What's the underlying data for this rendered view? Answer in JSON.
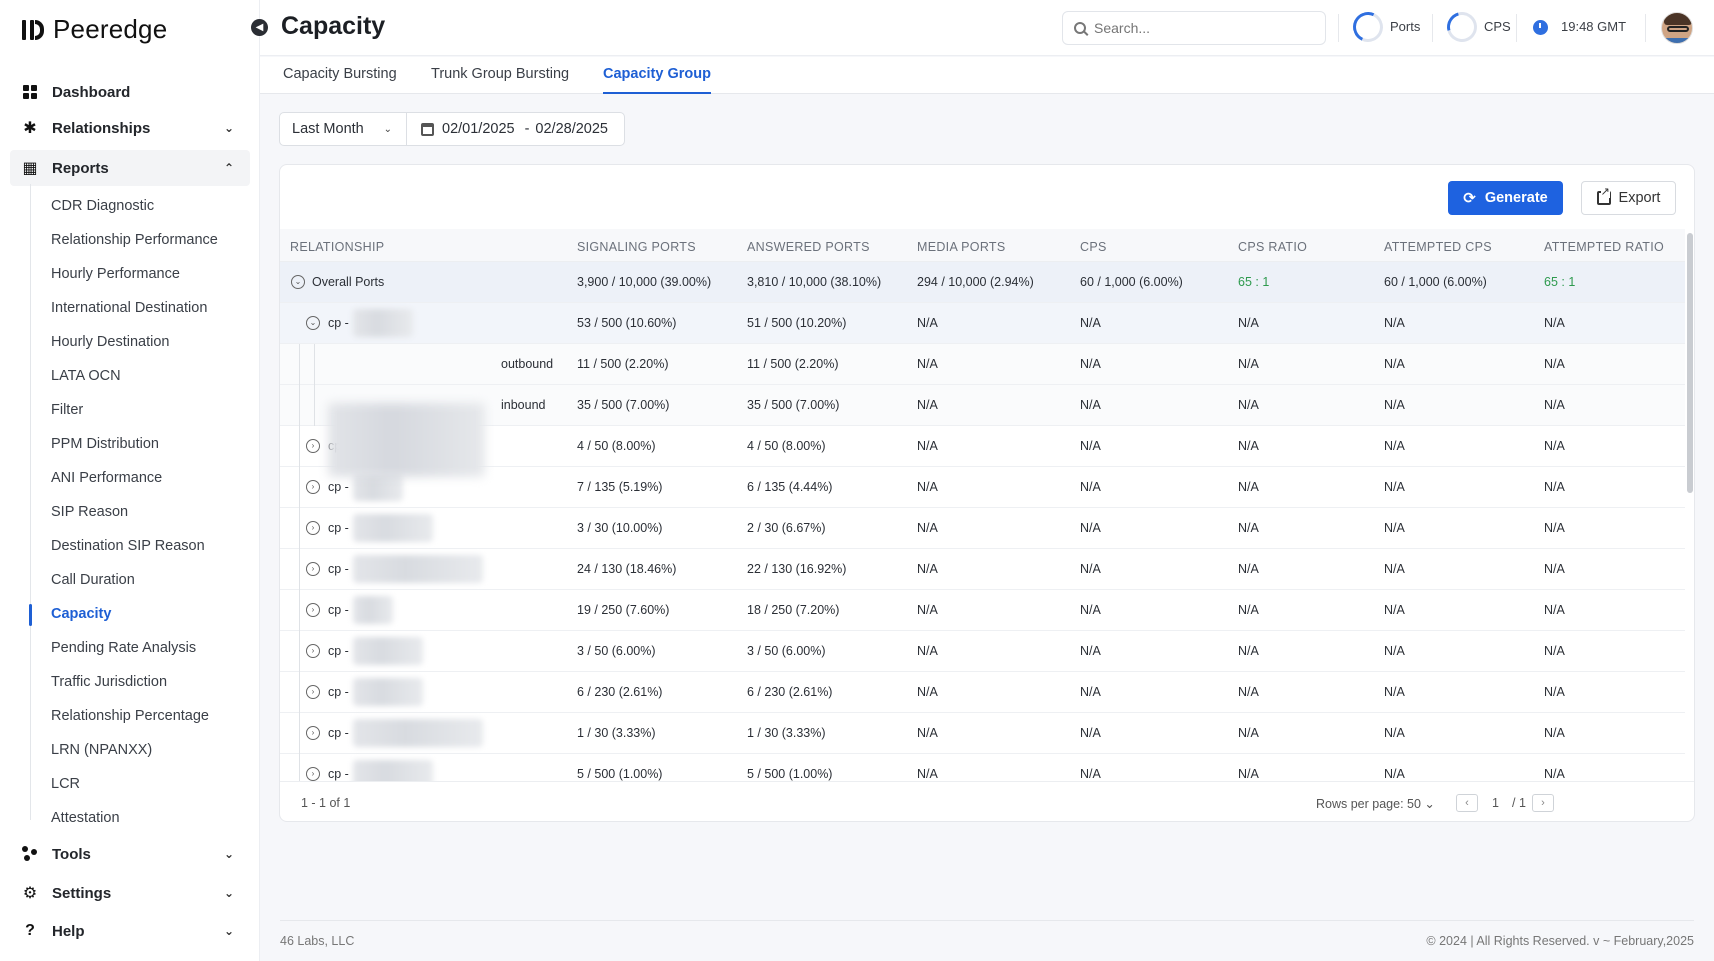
{
  "brand": {
    "name": "Peeredge"
  },
  "header": {
    "title": "Capacity",
    "search_placeholder": "Search...",
    "ports_label": "Ports",
    "cps_label": "CPS",
    "time": "19:48 GMT"
  },
  "nav": {
    "dashboard": "Dashboard",
    "relationships": "Relationships",
    "reports": "Reports",
    "tools": "Tools",
    "settings": "Settings",
    "help": "Help",
    "report_items": [
      "CDR Diagnostic",
      "Relationship Performance",
      "Hourly Performance",
      "International Destination",
      "Hourly Destination",
      "LATA OCN",
      "Filter",
      "PPM Distribution",
      "ANI Performance",
      "SIP Reason",
      "Destination SIP Reason",
      "Call Duration",
      "Capacity",
      "Pending Rate Analysis",
      "Traffic Jurisdiction",
      "Relationship Percentage",
      "LRN (NPANXX)",
      "LCR",
      "Attestation"
    ],
    "active_report": "Capacity"
  },
  "tabs": [
    "Capacity Bursting",
    "Trunk Group Bursting",
    "Capacity Group"
  ],
  "active_tab": "Capacity Group",
  "filter": {
    "period": "Last Month",
    "date_from": "02/01/2025",
    "date_sep": "-",
    "date_to": "02/28/2025"
  },
  "actions": {
    "generate": "Generate",
    "export": "Export"
  },
  "table": {
    "columns": [
      "RELATIONSHIP",
      "SIGNALING PORTS",
      "ANSWERED PORTS",
      "MEDIA PORTS",
      "CPS",
      "CPS RATIO",
      "ATTEMPTED CPS",
      "ATTEMPTED RATIO"
    ],
    "overall": {
      "relationship": "Overall Ports",
      "signaling": "3,900 / 10,000 (39.00%)",
      "answered": "3,810 / 10,000 (38.10%)",
      "media": "294 / 10,000 (2.94%)",
      "cps": "60 / 1,000 (6.00%)",
      "cps_ratio": "65 : 1",
      "attempted_cps": "60 / 1,000 (6.00%)",
      "attempted_ratio": "65 : 1"
    },
    "rows": [
      {
        "kind": "cp-open",
        "relationship": "cp -",
        "signaling": "53 / 500 (10.60%)",
        "answered": "51 / 500 (10.20%)",
        "media": "N/A",
        "cps": "N/A",
        "cps_ratio": "N/A",
        "attempted_cps": "N/A",
        "attempted_ratio": "N/A"
      },
      {
        "kind": "child",
        "relationship": "outbound",
        "signaling": "11 / 500 (2.20%)",
        "answered": "11 / 500 (2.20%)",
        "media": "N/A",
        "cps": "N/A",
        "cps_ratio": "N/A",
        "attempted_cps": "N/A",
        "attempted_ratio": "N/A"
      },
      {
        "kind": "child",
        "relationship": "inbound",
        "signaling": "35 / 500 (7.00%)",
        "answered": "35 / 500 (7.00%)",
        "media": "N/A",
        "cps": "N/A",
        "cps_ratio": "N/A",
        "attempted_cps": "N/A",
        "attempted_ratio": "N/A"
      },
      {
        "kind": "cp",
        "relationship": "cp -",
        "signaling": "4 / 50 (8.00%)",
        "answered": "4 / 50 (8.00%)",
        "media": "N/A",
        "cps": "N/A",
        "cps_ratio": "N/A",
        "attempted_cps": "N/A",
        "attempted_ratio": "N/A"
      },
      {
        "kind": "cp",
        "relationship": "cp -",
        "signaling": "7 / 135 (5.19%)",
        "answered": "6 / 135 (4.44%)",
        "media": "N/A",
        "cps": "N/A",
        "cps_ratio": "N/A",
        "attempted_cps": "N/A",
        "attempted_ratio": "N/A"
      },
      {
        "kind": "cp",
        "relationship": "cp -",
        "signaling": "3 / 30 (10.00%)",
        "answered": "2 / 30 (6.67%)",
        "media": "N/A",
        "cps": "N/A",
        "cps_ratio": "N/A",
        "attempted_cps": "N/A",
        "attempted_ratio": "N/A"
      },
      {
        "kind": "cp",
        "relationship": "cp -",
        "signaling": "24 / 130 (18.46%)",
        "answered": "22 / 130 (16.92%)",
        "media": "N/A",
        "cps": "N/A",
        "cps_ratio": "N/A",
        "attempted_cps": "N/A",
        "attempted_ratio": "N/A"
      },
      {
        "kind": "cp",
        "relationship": "cp -",
        "signaling": "19 / 250 (7.60%)",
        "answered": "18 / 250 (7.20%)",
        "media": "N/A",
        "cps": "N/A",
        "cps_ratio": "N/A",
        "attempted_cps": "N/A",
        "attempted_ratio": "N/A"
      },
      {
        "kind": "cp",
        "relationship": "cp -",
        "signaling": "3 / 50 (6.00%)",
        "answered": "3 / 50 (6.00%)",
        "media": "N/A",
        "cps": "N/A",
        "cps_ratio": "N/A",
        "attempted_cps": "N/A",
        "attempted_ratio": "N/A"
      },
      {
        "kind": "cp",
        "relationship": "cp -",
        "signaling": "6 / 230 (2.61%)",
        "answered": "6 / 230 (2.61%)",
        "media": "N/A",
        "cps": "N/A",
        "cps_ratio": "N/A",
        "attempted_cps": "N/A",
        "attempted_ratio": "N/A"
      },
      {
        "kind": "cp",
        "relationship": "cp -",
        "signaling": "1 / 30 (3.33%)",
        "answered": "1 / 30 (3.33%)",
        "media": "N/A",
        "cps": "N/A",
        "cps_ratio": "N/A",
        "attempted_cps": "N/A",
        "attempted_ratio": "N/A"
      },
      {
        "kind": "cp",
        "relationship": "cp -",
        "signaling": "5 / 500 (1.00%)",
        "answered": "5 / 500 (1.00%)",
        "media": "N/A",
        "cps": "N/A",
        "cps_ratio": "N/A",
        "attempted_cps": "N/A",
        "attempted_ratio": "N/A"
      }
    ]
  },
  "pagination": {
    "info": "1 - 1 of 1",
    "rows_per_page": "Rows per page: 50",
    "page": "1",
    "total": "/ 1"
  },
  "footer": {
    "company": "46 Labs, LLC",
    "rights": "© 2024 | All Rights Reserved. v ~ February,2025"
  },
  "colors": {
    "accent": "#1e62e0",
    "positive": "#2e9a4e"
  }
}
